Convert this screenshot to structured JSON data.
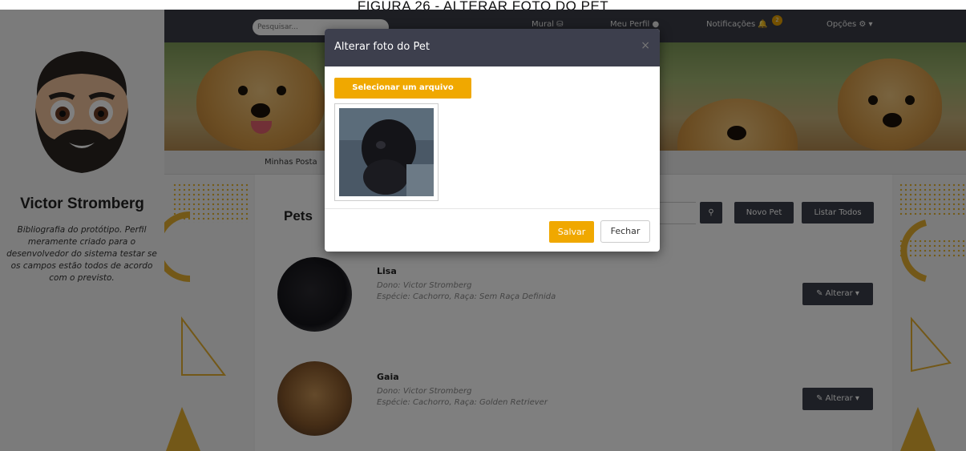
{
  "caption": "FIGURA 26 - ALTERAR FOTO DO PET",
  "nav": {
    "search_placeholder": "Pesquisar...",
    "mural": "Mural",
    "meu_perfil": "Meu Perfil",
    "notificacoes": "Notificações",
    "notification_count": "2",
    "opcoes": "Opções"
  },
  "profile": {
    "name": "Victor Stromberg",
    "bio": "Bibliografia do protótipo. Perfil meramente criado para o desenvolvedor do sistema testar se os campos estão todos de acordo com o previsto."
  },
  "tabs": {
    "minhas_postagens": "Minhas Posta"
  },
  "main": {
    "title": "Pets",
    "novo_pet": "Novo Pet",
    "listar_todos": "Listar Todos",
    "alterar": "Alterar"
  },
  "pets": [
    {
      "name": "Lisa",
      "owner": "Dono: Victor Stromberg",
      "info": "Espécie: Cachorro, Raça: Sem Raça Definida"
    },
    {
      "name": "Gaia",
      "owner": "Dono: Victor Stromberg",
      "info": "Espécie: Cachorro, Raça: Golden Retriever"
    }
  ],
  "modal": {
    "title": "Alterar foto do Pet",
    "close": "×",
    "select_file": "Selecionar um arquivo",
    "save": "Salvar",
    "close_button": "Fechar"
  },
  "colors": {
    "accent": "#f0a800",
    "navbar": "#3a3d47",
    "modal_header": "#3d3f4d"
  }
}
